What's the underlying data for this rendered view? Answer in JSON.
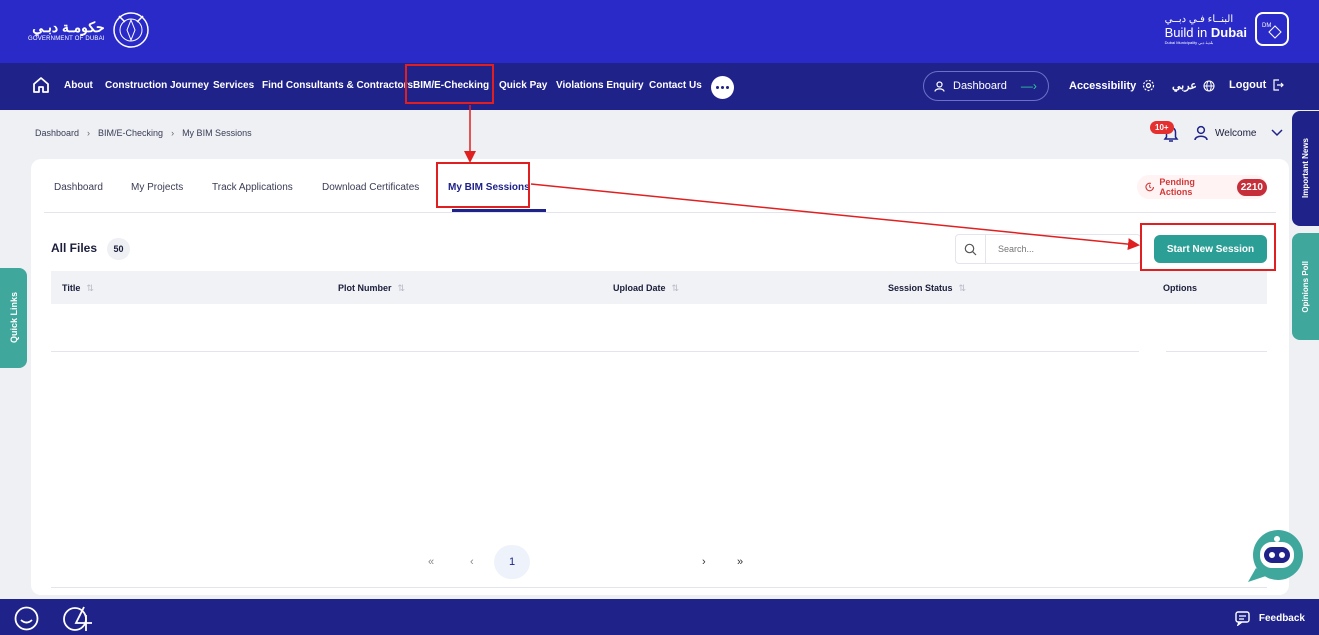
{
  "header": {
    "gov_ar": "حكومـة دبـي",
    "gov_en": "GOVERNMENT OF DUBAI",
    "bid_ar": "البنــاء فـي دبــي",
    "bid_en_1": "Build in ",
    "bid_en_2": "Dubai",
    "bid_sub": "Dubai Municipality بلدية دبي",
    "bid_mark": "DM"
  },
  "nav": {
    "items": [
      "About",
      "Construction Journey",
      "Services",
      "Find Consultants & Contractors",
      "BIM/E-Checking",
      "Quick Pay",
      "Violations Enquiry",
      "Contact Us"
    ],
    "dashboard": "Dashboard",
    "accessibility": "Accessibility",
    "language": "عربي",
    "logout": "Logout"
  },
  "breadcrumb": [
    "Dashboard",
    "BIM/E-Checking",
    "My BIM Sessions"
  ],
  "user": {
    "notif_badge": "10+",
    "welcome": "Welcome"
  },
  "tabs": [
    "Dashboard",
    "My Projects",
    "Track Applications",
    "Download Certificates",
    "My BIM Sessions"
  ],
  "pending": {
    "label": "Pending Actions",
    "count": "2210"
  },
  "files": {
    "title": "All Files",
    "count": "50",
    "search_placeholder": "Search...",
    "start_label": "Start New Session"
  },
  "table": {
    "columns": [
      "Title",
      "Plot Number",
      "Upload Date",
      "Session Status",
      "Options"
    ],
    "rows": []
  },
  "pager": {
    "first": "«",
    "prev": "‹",
    "page": "1",
    "next": "›",
    "last": "»"
  },
  "side": {
    "quick_links": "Quick Links",
    "important_news": "Important News",
    "opinions_poll": "Opinions Poll"
  },
  "footer": {
    "feedback": "Feedback"
  },
  "colors": {
    "top_bar": "#2a2ac9",
    "nav_bar": "#1f2289",
    "accent_teal": "#2b9f95",
    "annotation_red": "#e02020"
  }
}
